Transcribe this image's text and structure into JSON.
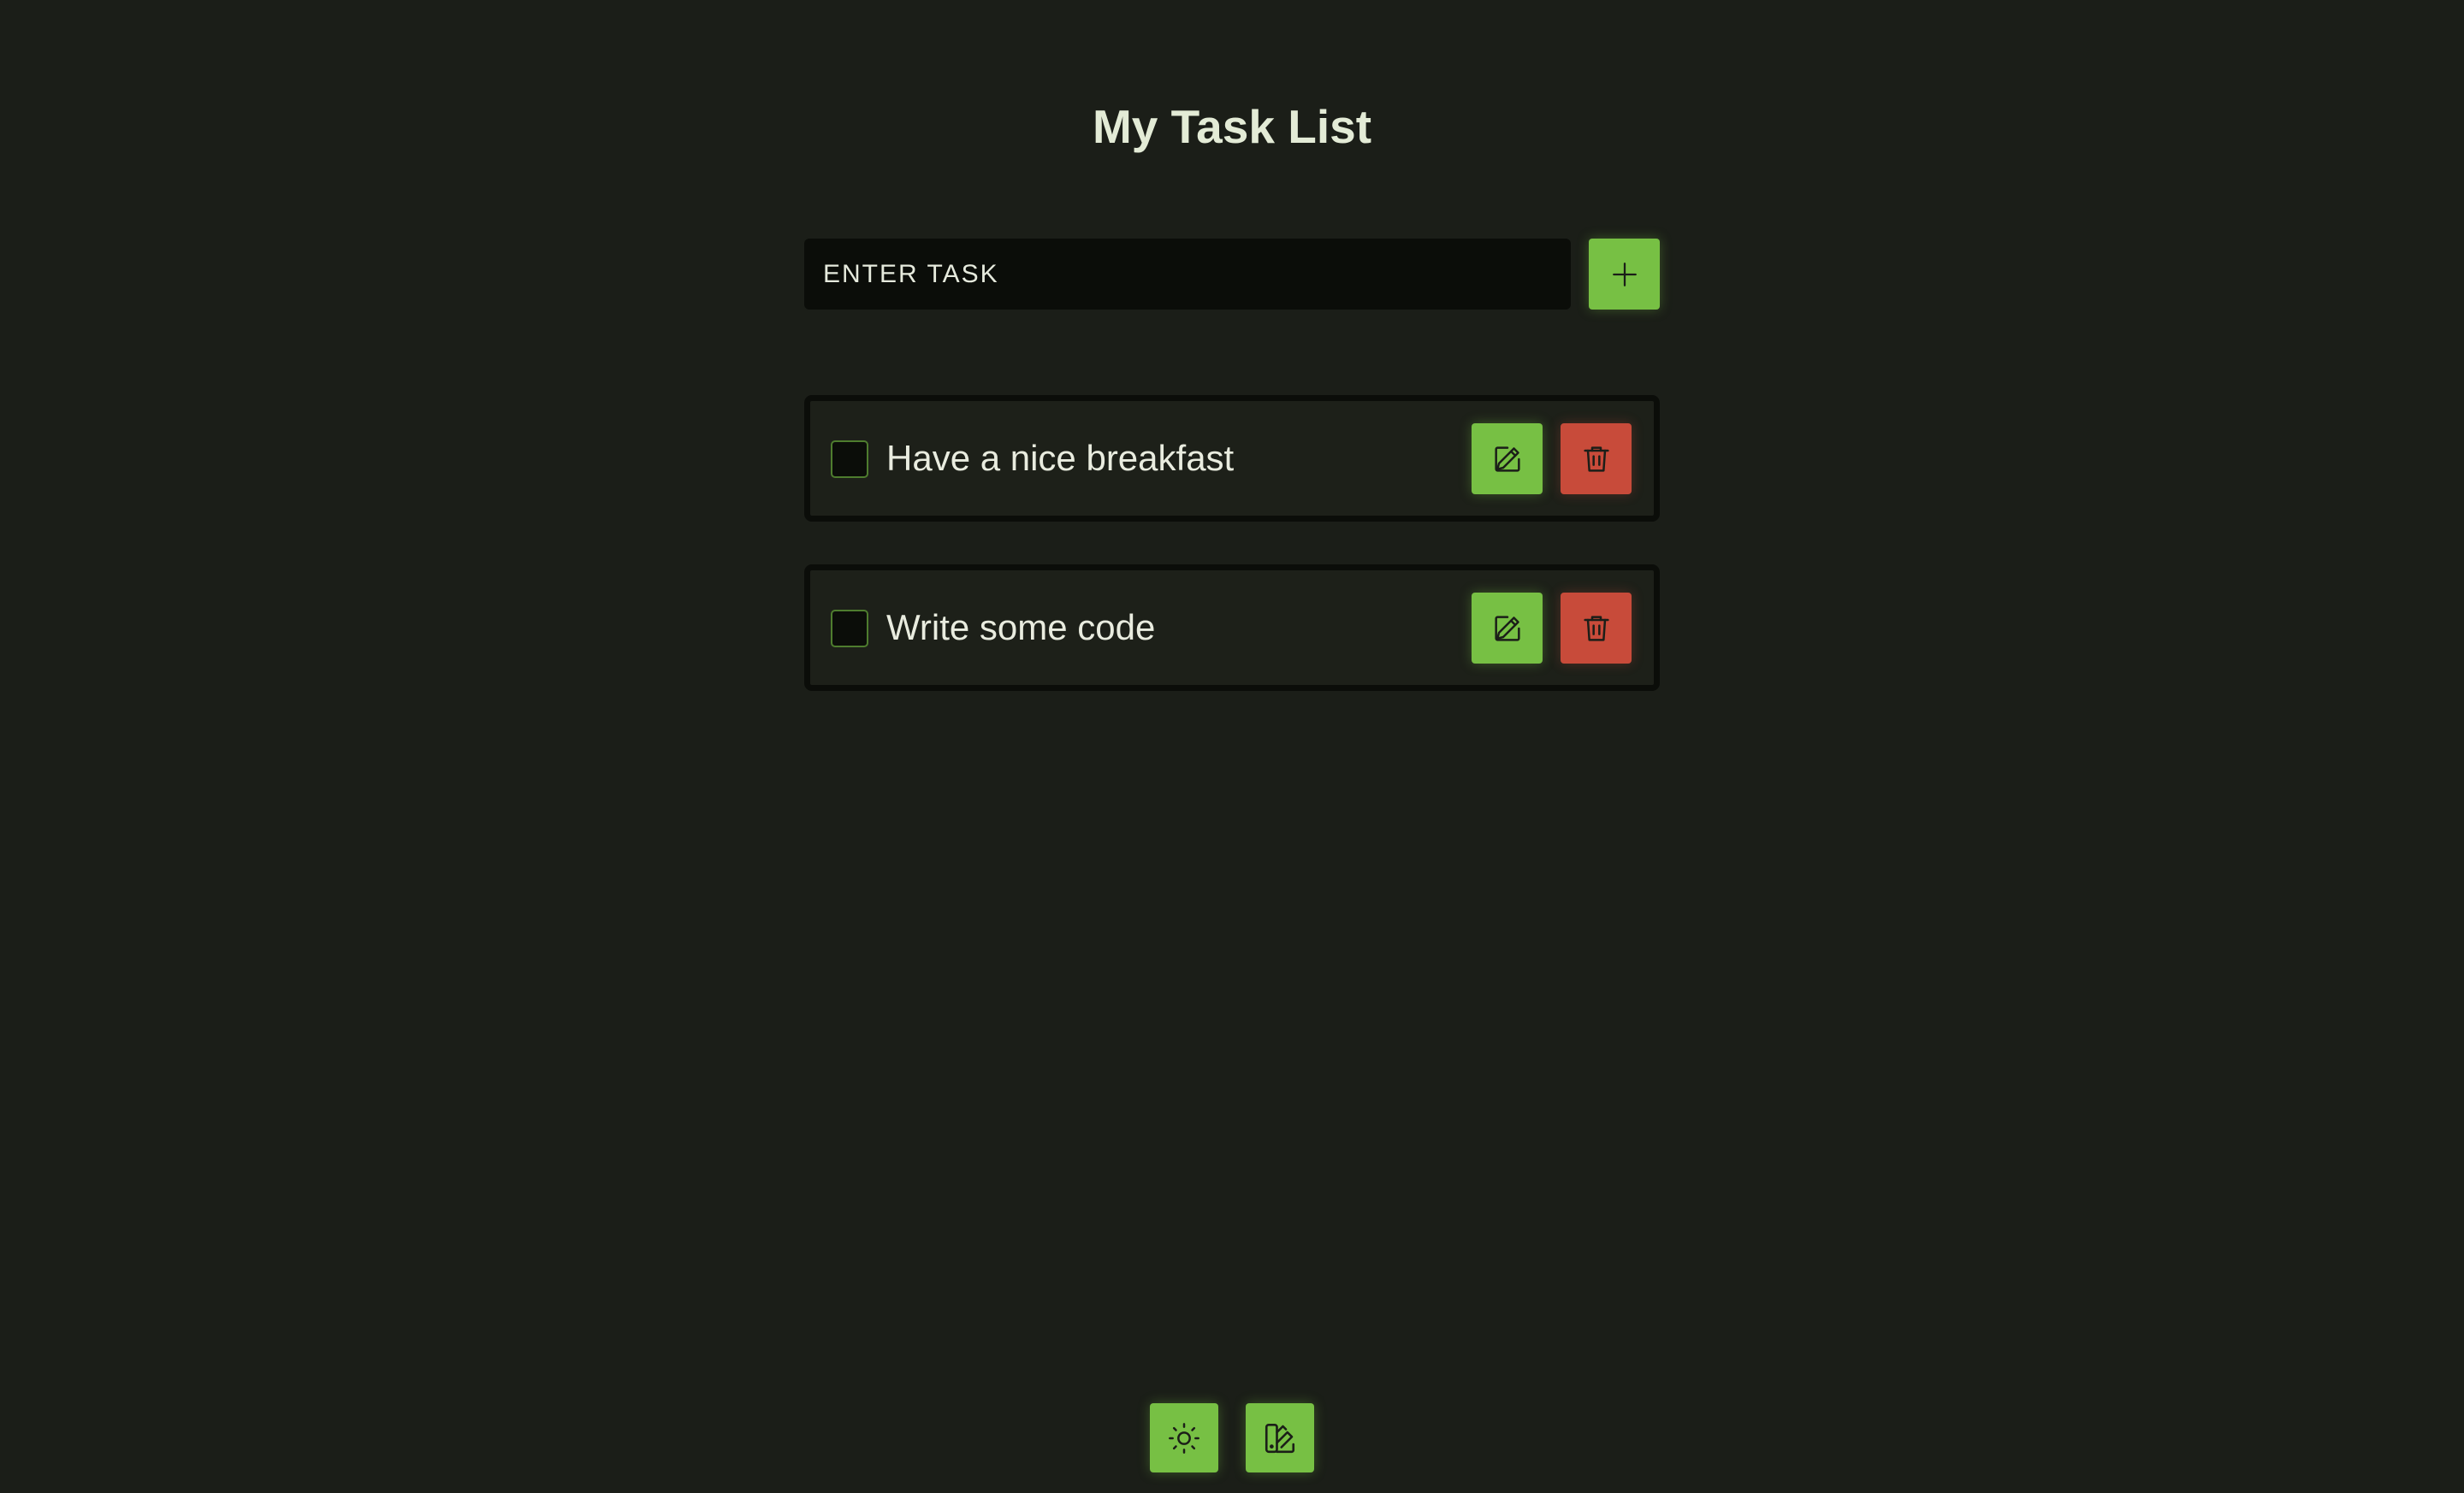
{
  "page": {
    "title": "My Task List"
  },
  "add_form": {
    "input_placeholder": "ENTER TASK",
    "input_value": "",
    "add_icon": "plus-icon"
  },
  "tasks": [
    {
      "text": "Have a nice breakfast",
      "completed": false,
      "edit_icon": "pencil-icon",
      "delete_icon": "trash-icon"
    },
    {
      "text": "Write some code",
      "completed": false,
      "edit_icon": "pencil-icon",
      "delete_icon": "trash-icon"
    }
  ],
  "footer": {
    "buttons": [
      {
        "icon": "sun-icon"
      },
      {
        "icon": "palette-icon"
      }
    ]
  },
  "colors": {
    "background": "#1b1e18",
    "accent_green": "#77c044",
    "danger_red": "#c84b3a",
    "input_background": "#0b0d09",
    "text": "#e6eadd"
  }
}
